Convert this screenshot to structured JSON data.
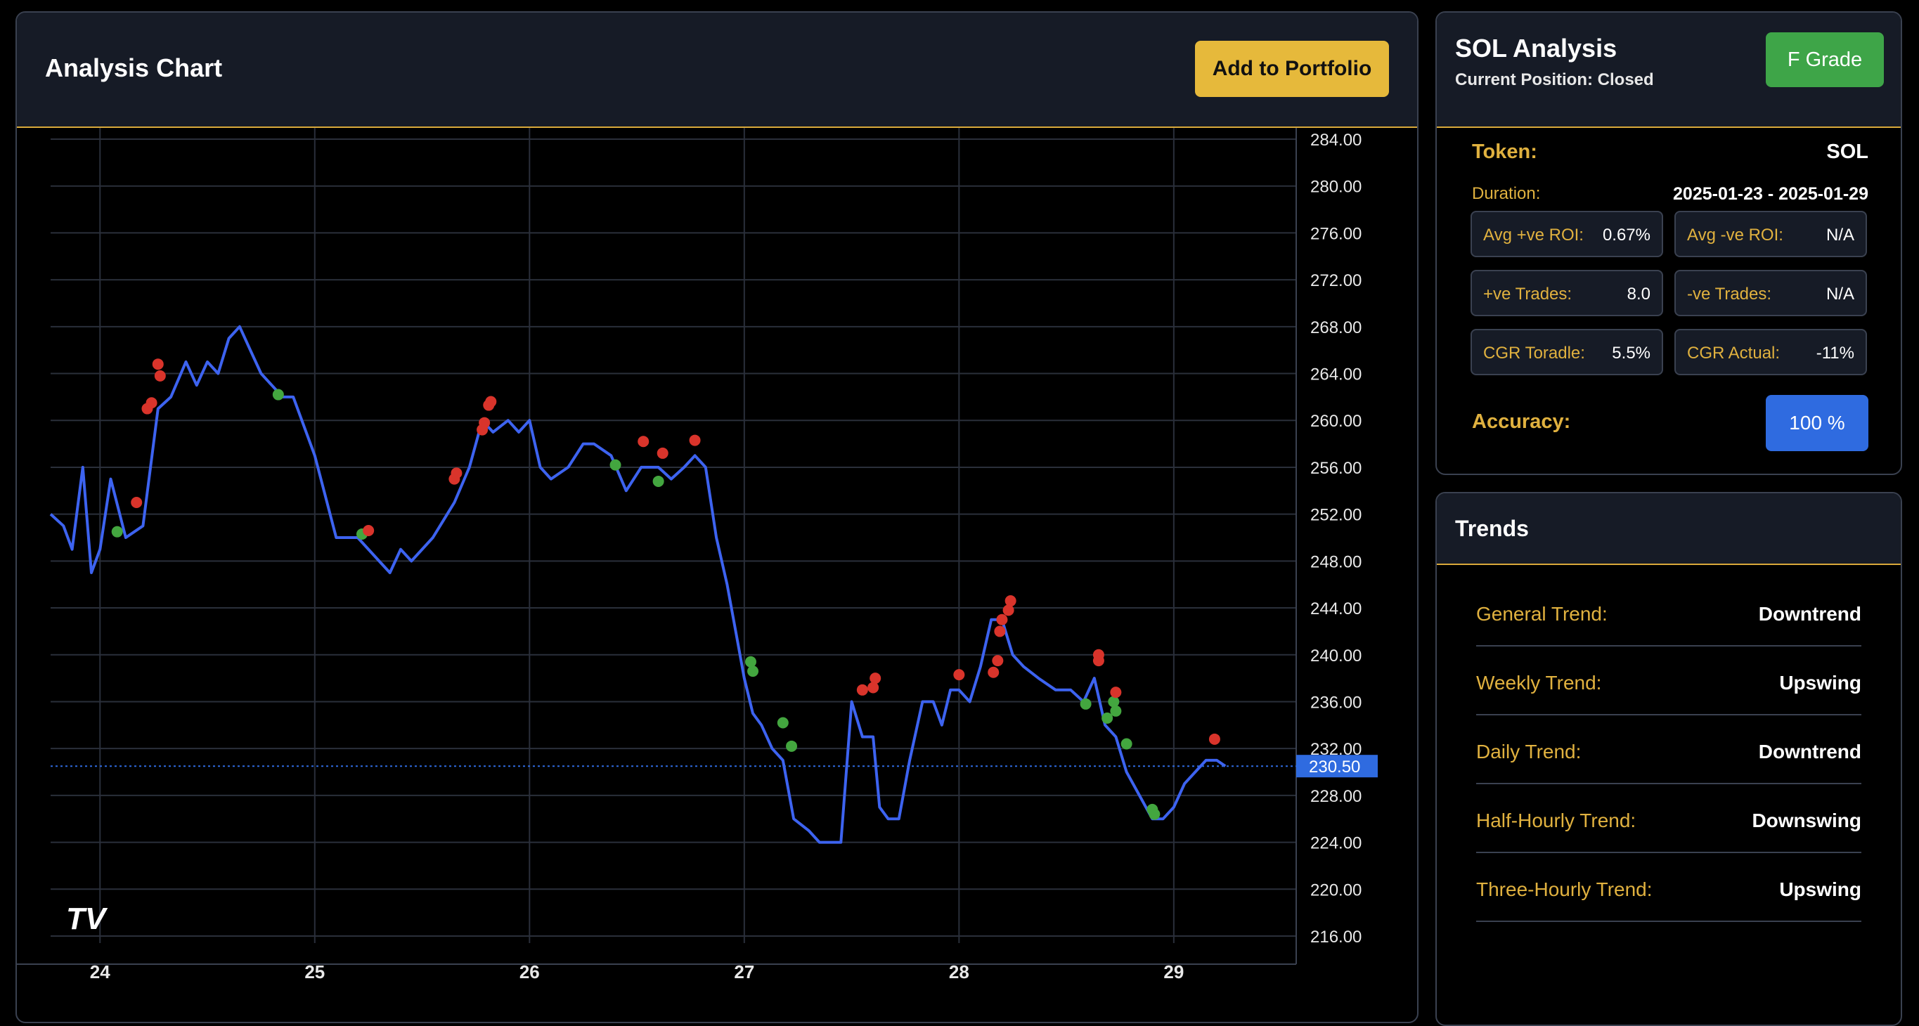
{
  "chart_header": {
    "title": "Analysis Chart",
    "add_button": "Add to Portfolio"
  },
  "analysis": {
    "title": "SOL Analysis",
    "subtitle": "Current Position: Closed",
    "grade": "F Grade",
    "token_label": "Token:",
    "token_value": "SOL",
    "duration_label": "Duration:",
    "duration_value": "2025-01-23 - 2025-01-29",
    "stats": [
      {
        "label": "Avg +ve ROI:",
        "value": "0.67%"
      },
      {
        "label": "Avg -ve ROI:",
        "value": "N/A"
      },
      {
        "label": "+ve Trades:",
        "value": "8.0"
      },
      {
        "label": "-ve Trades:",
        "value": "N/A"
      },
      {
        "label": "CGR Toradle:",
        "value": "5.5%"
      },
      {
        "label": "CGR Actual:",
        "value": "-11%"
      }
    ],
    "accuracy_label": "Accuracy:",
    "accuracy_value": "100 %"
  },
  "trends": {
    "title": "Trends",
    "rows": [
      {
        "label": "General Trend:",
        "value": "Downtrend"
      },
      {
        "label": "Weekly Trend:",
        "value": "Upswing"
      },
      {
        "label": "Daily Trend:",
        "value": "Downtrend"
      },
      {
        "label": "Half-Hourly Trend:",
        "value": "Downswing"
      },
      {
        "label": "Three-Hourly Trend:",
        "value": "Upswing"
      }
    ]
  },
  "colors": {
    "line": "#3d63f0",
    "buy_marker": "#43a63f",
    "sell_marker": "#d9342b",
    "accent": "#e0b13f",
    "price_tag": "#2f6be0"
  },
  "chart_data": {
    "type": "line",
    "x_ticks": [
      "24",
      "25",
      "26",
      "27",
      "28",
      "29"
    ],
    "y_ticks": [
      "284.00",
      "280.00",
      "276.00",
      "272.00",
      "268.00",
      "264.00",
      "260.00",
      "256.00",
      "252.00",
      "248.00",
      "244.00",
      "240.00",
      "236.00",
      "232.00",
      "228.00",
      "224.00",
      "220.00",
      "216.00"
    ],
    "ylim": [
      216,
      284
    ],
    "xlim": [
      23.77,
      29.57
    ],
    "current_price": "230.50",
    "logo": "TV",
    "series": [
      {
        "x": [
          23.77,
          23.83,
          23.87,
          23.92,
          23.96,
          24.0,
          24.05,
          24.12,
          24.2,
          24.27,
          24.33,
          24.4,
          24.45,
          24.5,
          24.55,
          24.6,
          24.65,
          24.7,
          24.75,
          24.8,
          24.85,
          24.9,
          25.0,
          25.1,
          25.2,
          25.3,
          25.35,
          25.4,
          25.45,
          25.55,
          25.65,
          25.72,
          25.78,
          25.83,
          25.9,
          25.95,
          26.0,
          26.05,
          26.1,
          26.18,
          26.25,
          26.3,
          26.38,
          26.45,
          26.52,
          26.6,
          26.66,
          26.72,
          26.77,
          26.82,
          26.87,
          26.92,
          26.97,
          27.0,
          27.04,
          27.08,
          27.13,
          27.18,
          27.23,
          27.3,
          27.35,
          27.4,
          27.45,
          27.5,
          27.55,
          27.6,
          27.63,
          27.67,
          27.72,
          27.77,
          27.83,
          27.88,
          27.92,
          27.96,
          28.0,
          28.05,
          28.1,
          28.15,
          28.2,
          28.25,
          28.3,
          28.37,
          28.45,
          28.52,
          28.58,
          28.63,
          28.68,
          28.73,
          28.78,
          28.84,
          28.9,
          28.95,
          29.0,
          29.05,
          29.1,
          29.15,
          29.2,
          29.24
        ],
        "y": [
          252,
          251,
          249,
          256,
          247,
          249,
          255,
          250,
          251,
          261,
          262,
          265,
          263,
          265,
          264,
          267,
          268,
          266,
          264,
          263,
          262,
          262,
          257,
          250,
          250,
          248,
          247,
          249,
          248,
          250,
          253,
          256,
          260,
          259,
          260,
          259,
          260,
          256,
          255,
          256,
          258,
          258,
          257,
          254,
          256,
          256,
          255,
          256,
          257,
          256,
          250,
          246,
          241,
          238,
          235,
          234,
          232,
          231,
          226,
          225,
          224,
          224,
          224,
          236,
          233,
          233,
          227,
          226,
          226,
          231,
          236,
          236,
          234,
          237,
          237,
          236,
          239,
          243,
          243,
          240,
          239,
          238,
          237,
          237,
          236,
          238,
          234,
          233,
          230,
          228,
          226,
          226,
          227,
          229,
          230,
          231,
          231,
          230.5
        ]
      }
    ],
    "buy_markers": [
      {
        "x": 24.08,
        "y": 250.5
      },
      {
        "x": 24.83,
        "y": 262.2
      },
      {
        "x": 25.22,
        "y": 250.3
      },
      {
        "x": 26.4,
        "y": 256.2
      },
      {
        "x": 26.6,
        "y": 254.8
      },
      {
        "x": 27.03,
        "y": 239.4
      },
      {
        "x": 27.04,
        "y": 238.6
      },
      {
        "x": 27.18,
        "y": 234.2
      },
      {
        "x": 27.22,
        "y": 232.2
      },
      {
        "x": 28.59,
        "y": 235.8
      },
      {
        "x": 28.69,
        "y": 234.6
      },
      {
        "x": 28.72,
        "y": 236.0
      },
      {
        "x": 28.73,
        "y": 235.2
      },
      {
        "x": 28.78,
        "y": 232.4
      },
      {
        "x": 28.9,
        "y": 226.8
      },
      {
        "x": 28.91,
        "y": 226.4
      }
    ],
    "sell_markers": [
      {
        "x": 24.17,
        "y": 253.0
      },
      {
        "x": 24.22,
        "y": 261.0
      },
      {
        "x": 24.24,
        "y": 261.5
      },
      {
        "x": 24.27,
        "y": 264.8
      },
      {
        "x": 24.28,
        "y": 263.8
      },
      {
        "x": 25.25,
        "y": 250.6
      },
      {
        "x": 25.65,
        "y": 255.0
      },
      {
        "x": 25.66,
        "y": 255.5
      },
      {
        "x": 25.78,
        "y": 259.2
      },
      {
        "x": 25.79,
        "y": 259.8
      },
      {
        "x": 25.81,
        "y": 261.3
      },
      {
        "x": 25.82,
        "y": 261.6
      },
      {
        "x": 26.53,
        "y": 258.2
      },
      {
        "x": 26.62,
        "y": 257.2
      },
      {
        "x": 26.77,
        "y": 258.3
      },
      {
        "x": 27.55,
        "y": 237.0
      },
      {
        "x": 27.6,
        "y": 237.2
      },
      {
        "x": 27.61,
        "y": 238.0
      },
      {
        "x": 28.0,
        "y": 238.3
      },
      {
        "x": 28.16,
        "y": 238.5
      },
      {
        "x": 28.18,
        "y": 239.5
      },
      {
        "x": 28.19,
        "y": 242.0
      },
      {
        "x": 28.2,
        "y": 243.0
      },
      {
        "x": 28.23,
        "y": 243.8
      },
      {
        "x": 28.24,
        "y": 244.6
      },
      {
        "x": 28.65,
        "y": 239.5
      },
      {
        "x": 28.65,
        "y": 240.0
      },
      {
        "x": 28.73,
        "y": 236.8
      },
      {
        "x": 29.19,
        "y": 232.8
      }
    ]
  }
}
